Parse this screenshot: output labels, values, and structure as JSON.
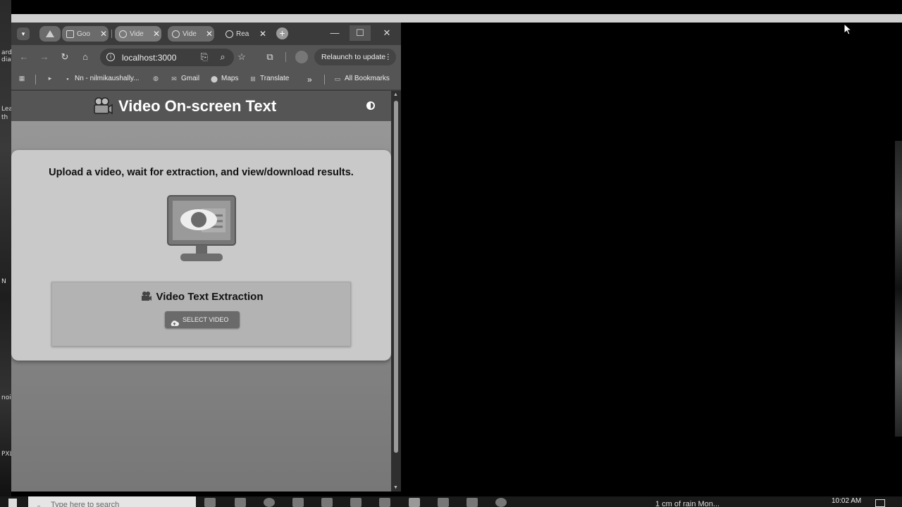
{
  "browser": {
    "tabs": [
      {
        "label": "Goo",
        "icon": "google-icon"
      },
      {
        "label": "Vide",
        "icon": "globe-icon"
      },
      {
        "label": "Vide",
        "icon": "app-icon"
      },
      {
        "label": "Rea",
        "icon": "react-icon"
      }
    ],
    "url": "localhost:3000",
    "relaunch_label": "Relaunch to update",
    "bookmarks": [
      {
        "label": "Nn - nilmikaushally...",
        "icon": "bookmark-site-icon"
      },
      {
        "label": "Gmail",
        "icon": "gmail-icon"
      },
      {
        "label": "Maps",
        "icon": "maps-icon"
      },
      {
        "label": "Translate",
        "icon": "translate-icon"
      }
    ],
    "all_bookmarks": "All Bookmarks"
  },
  "app": {
    "title": "Video On-screen Text",
    "subtitle": "Upload a video, wait for extraction, and view/download results.",
    "panel_title": "Video Text Extraction",
    "select_button": "SELECT VIDEO"
  },
  "taskbar": {
    "search_placeholder": "Type here to search",
    "weather": "1 cm of rain Mon...",
    "time": "10:02 AM"
  },
  "desktop": {
    "labels": [
      "Lea",
      "th",
      "ard",
      "dia",
      "N",
      "noi",
      "PXL"
    ]
  }
}
